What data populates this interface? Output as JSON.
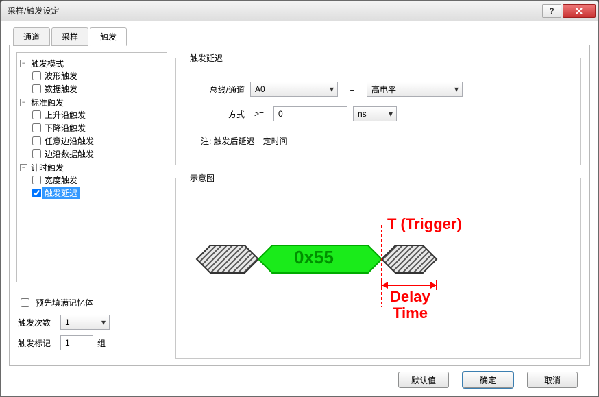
{
  "window": {
    "title": "采样/触发设定"
  },
  "tabs": [
    {
      "label": "通道",
      "active": false
    },
    {
      "label": "采样",
      "active": false
    },
    {
      "label": "触发",
      "active": true
    }
  ],
  "tree": {
    "nodes": [
      {
        "label": "触发模式",
        "children": [
          {
            "label": "波形触发",
            "checked": false
          },
          {
            "label": "数据触发",
            "checked": false
          }
        ]
      },
      {
        "label": "标准触发",
        "children": [
          {
            "label": "上升沿触发",
            "checked": false
          },
          {
            "label": "下降沿触发",
            "checked": false
          },
          {
            "label": "任意边沿触发",
            "checked": false
          },
          {
            "label": "边沿数据触发",
            "checked": false
          }
        ]
      },
      {
        "label": "计时触发",
        "children": [
          {
            "label": "宽度触发",
            "checked": false
          },
          {
            "label": "触发延迟",
            "checked": true,
            "selected": true
          }
        ]
      }
    ]
  },
  "options": {
    "prefill_label": "预先填满记忆体",
    "prefill_checked": false,
    "trigger_count_label": "触发次数",
    "trigger_count_value": "1",
    "trigger_mark_label": "触发标记",
    "trigger_mark_value": "1",
    "trigger_mark_unit": "组"
  },
  "settings": {
    "group_title": "触发延迟",
    "bus_label": "总线/通道",
    "bus_value": "A0",
    "equals": "=",
    "level_value": "高电平",
    "mode_label": "方式",
    "mode_op": ">=",
    "mode_value": "0",
    "mode_unit": "ns",
    "note": "注: 触发后延迟一定时间"
  },
  "diagram": {
    "group_title": "示意图",
    "trigger_label": "T (Trigger)",
    "data_label": "0x55",
    "delay_label_1": "Delay",
    "delay_label_2": "Time"
  },
  "buttons": {
    "default": "默认值",
    "ok": "确定",
    "cancel": "取消"
  }
}
